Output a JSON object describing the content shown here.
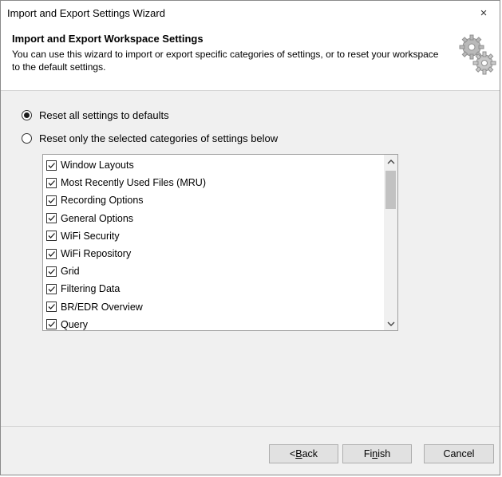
{
  "window": {
    "title": "Import and Export Settings Wizard",
    "close_label": "×"
  },
  "header": {
    "title": "Import and Export Workspace Settings",
    "description": "You can use this wizard to import or export specific categories of settings, or to reset your workspace to the default settings."
  },
  "options": {
    "reset_all": {
      "label": "Reset all settings to defaults",
      "checked": true
    },
    "reset_selected": {
      "label": "Reset only the selected categories of settings below",
      "checked": false
    }
  },
  "categories": [
    {
      "label": "Window Layouts",
      "checked": true
    },
    {
      "label": "Most Recently Used Files (MRU)",
      "checked": true
    },
    {
      "label": "Recording Options",
      "checked": true
    },
    {
      "label": "General Options",
      "checked": true
    },
    {
      "label": "WiFi Security",
      "checked": true
    },
    {
      "label": "WiFi Repository",
      "checked": true
    },
    {
      "label": "Grid",
      "checked": true
    },
    {
      "label": "Filtering Data",
      "checked": true
    },
    {
      "label": "BR/EDR Overview",
      "checked": true
    },
    {
      "label": "Query",
      "checked": true
    }
  ],
  "buttons": {
    "back": {
      "prefix": "< ",
      "accel": "B",
      "rest": "ack"
    },
    "finish": {
      "prefix": "Fi",
      "accel": "n",
      "rest": "ish"
    },
    "cancel": {
      "label": "Cancel"
    }
  },
  "icons": {
    "gears": "gears-icon",
    "scroll_up": "chevron-up-icon",
    "scroll_down": "chevron-down-icon"
  }
}
